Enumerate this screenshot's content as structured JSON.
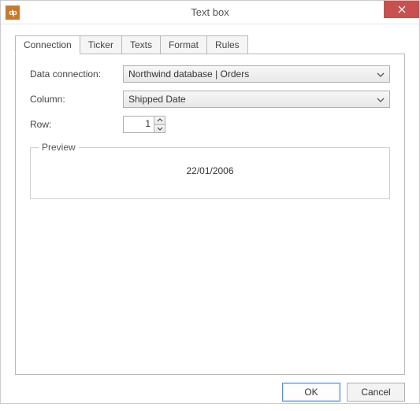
{
  "window": {
    "title": "Text box",
    "app_icon_text": "dp"
  },
  "tabs": [
    {
      "label": "Connection",
      "active": true
    },
    {
      "label": "Ticker",
      "active": false
    },
    {
      "label": "Texts",
      "active": false
    },
    {
      "label": "Format",
      "active": false
    },
    {
      "label": "Rules",
      "active": false
    }
  ],
  "form": {
    "data_connection_label": "Data connection:",
    "data_connection_value": "Northwind database | Orders",
    "column_label": "Column:",
    "column_value": "Shipped Date",
    "row_label": "Row:",
    "row_value": "1"
  },
  "preview": {
    "legend": "Preview",
    "value": "22/01/2006"
  },
  "buttons": {
    "ok": "OK",
    "cancel": "Cancel"
  }
}
